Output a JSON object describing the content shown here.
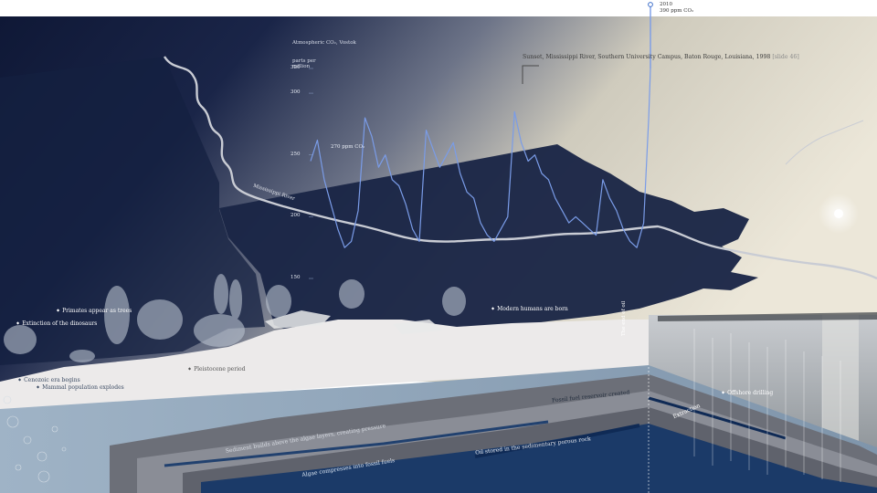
{
  "caption": {
    "text": "Sunset, Mississippi River, Southern University Campus, Baton Rouge, Louisiana, 1998",
    "ref": "[slide 46]"
  },
  "river_label": "Mississippi River",
  "timeline_label": "The end of oil",
  "events": {
    "primates": "Primates appear as trees",
    "dinosaurs": "Extinction of the dinosaurs",
    "humans": "Modern humans are born",
    "pleistocene": "Pleistocene period",
    "cenozoic": "Cenozoic era begins",
    "mammal": "Mammal population explodes",
    "fossil_formed": "Fossil fuel reservoir created",
    "drilling": "Offshore drilling",
    "extraction": "Extraction",
    "sediment": "Sediment builds above the algae layers, creating pressure",
    "oil_created": "Oil stored in the sedimentary porous rock",
    "algae": "Algae compresses into fossil fuels"
  },
  "chart_data": {
    "type": "line",
    "title": "Atmospheric CO₂, Vostok",
    "ylabel": "parts per million",
    "ylim": [
      150,
      320
    ],
    "yticks": [
      150,
      200,
      250,
      300,
      320
    ],
    "annotations": [
      {
        "label": "270 ppm CO₂",
        "x": 0.9,
        "y": 270
      },
      {
        "label": "390 ppm CO₂",
        "year": "2010",
        "x": 1.0,
        "y": 390
      }
    ],
    "series": [
      {
        "x": [
          0.0,
          0.02,
          0.04,
          0.06,
          0.08,
          0.1,
          0.12,
          0.14,
          0.16,
          0.18,
          0.2,
          0.22,
          0.24,
          0.26,
          0.28,
          0.3,
          0.32,
          0.34,
          0.36,
          0.38,
          0.4,
          0.42,
          0.44,
          0.46,
          0.48,
          0.5,
          0.52,
          0.54,
          0.56,
          0.58,
          0.6,
          0.62,
          0.64,
          0.66,
          0.68,
          0.7,
          0.72,
          0.74,
          0.76,
          0.78,
          0.8,
          0.82,
          0.84,
          0.86,
          0.88,
          0.9,
          0.92,
          0.94,
          0.96,
          0.98,
          0.995,
          1.0
        ],
        "y": [
          245,
          262,
          230,
          210,
          190,
          175,
          180,
          205,
          280,
          265,
          240,
          250,
          230,
          225,
          210,
          190,
          180,
          270,
          255,
          240,
          250,
          260,
          235,
          220,
          215,
          195,
          185,
          180,
          190,
          200,
          285,
          260,
          245,
          250,
          235,
          230,
          215,
          205,
          195,
          200,
          195,
          190,
          185,
          230,
          215,
          205,
          190,
          180,
          175,
          195,
          280,
          390
        ]
      }
    ]
  },
  "colors": {
    "sky_night": "#10193a",
    "sky_day": "#e9e3d4",
    "co2_line": "#7a9ce8",
    "river": "#c8ccd4",
    "sea": "#b9c5cf"
  }
}
